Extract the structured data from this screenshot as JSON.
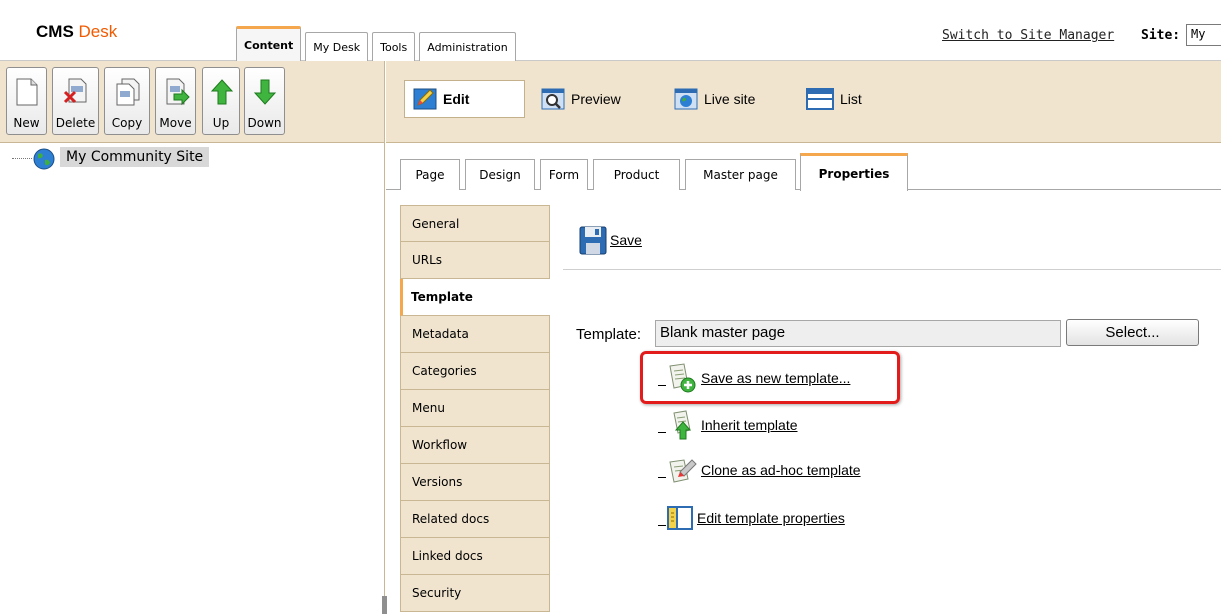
{
  "app": {
    "logo_bold": "CMS",
    "logo_accent": "Desk"
  },
  "main_tabs": [
    {
      "label": "Content",
      "active": true
    },
    {
      "label": "My Desk",
      "active": false
    },
    {
      "label": "Tools",
      "active": false
    },
    {
      "label": "Administration",
      "active": false
    }
  ],
  "header": {
    "switch_link": "Switch to Site Manager",
    "site_label": "Site:",
    "site_value": "My"
  },
  "toolbar": {
    "buttons": [
      {
        "label": "New",
        "icon": "new-document-icon"
      },
      {
        "label": "Delete",
        "icon": "delete-document-icon"
      },
      {
        "label": "Copy",
        "icon": "copy-document-icon"
      },
      {
        "label": "Move",
        "icon": "move-document-icon"
      },
      {
        "label": "Up",
        "icon": "arrow-up-icon"
      },
      {
        "label": "Down",
        "icon": "arrow-down-icon"
      }
    ]
  },
  "tree": {
    "root": "My Community Site"
  },
  "modes": [
    {
      "label": "Edit",
      "icon": "edit-icon",
      "active": true
    },
    {
      "label": "Preview",
      "icon": "preview-icon",
      "active": false
    },
    {
      "label": "Live site",
      "icon": "live-site-icon",
      "active": false
    },
    {
      "label": "List",
      "icon": "list-icon",
      "active": false
    }
  ],
  "sub_tabs": [
    {
      "label": "Page",
      "active": false
    },
    {
      "label": "Design",
      "active": false
    },
    {
      "label": "Form",
      "active": false
    },
    {
      "label": "Product",
      "active": false
    },
    {
      "label": "Master page",
      "active": false
    },
    {
      "label": "Properties",
      "active": true
    }
  ],
  "properties_menu": [
    {
      "label": "General",
      "active": false
    },
    {
      "label": "URLs",
      "active": false
    },
    {
      "label": "Template",
      "active": true
    },
    {
      "label": "Metadata",
      "active": false
    },
    {
      "label": "Categories",
      "active": false
    },
    {
      "label": "Menu",
      "active": false
    },
    {
      "label": "Workflow",
      "active": false
    },
    {
      "label": "Versions",
      "active": false
    },
    {
      "label": "Related docs",
      "active": false
    },
    {
      "label": "Linked docs",
      "active": false
    },
    {
      "label": "Security",
      "active": false
    }
  ],
  "content": {
    "save_label": "Save",
    "template_label": "Template:",
    "template_value": "Blank master page",
    "select_label": "Select...",
    "actions": [
      {
        "label": "Save as new template...",
        "icon": "save-template-icon",
        "highlighted": true
      },
      {
        "label": "Inherit template",
        "icon": "inherit-template-icon",
        "highlighted": false
      },
      {
        "label": "Clone as ad-hoc template",
        "icon": "clone-template-icon",
        "highlighted": false
      },
      {
        "label": "Edit template properties",
        "icon": "template-properties-icon",
        "highlighted": false
      }
    ]
  },
  "colors": {
    "accent_orange": "#f05a00",
    "tab_highlight": "#f5a74d",
    "panel_beige": "#f0e4cf",
    "highlight_red": "#e21b1b"
  }
}
